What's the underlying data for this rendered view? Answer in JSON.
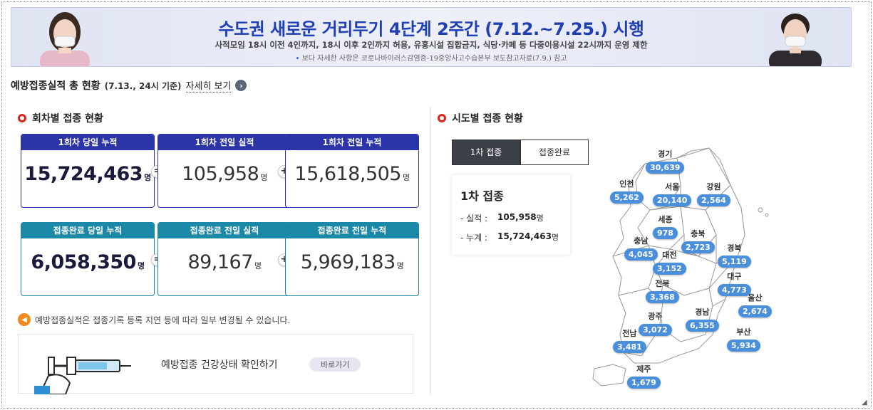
{
  "banner": {
    "title": "수도권 새로운 거리두기 4단계 2주간 (7.12.~7.25.) 시행",
    "subtitle": "사적모임 18시 이전 4인까지, 18시 이후 2인까지 허용, 유흥시설 집합금지, 식당·카페 등 다중이용시설 22시까지 운영 제한",
    "note": "보다 자세한 사항은 코로나바이러스감염증-19중앙사고수습본부 보도참고자료(7.9.) 참고"
  },
  "summary": {
    "title": "예방접종실적 총 현황",
    "date": "(7.13., 24시 기준)",
    "more_label": "자세히 보기"
  },
  "by_dose": {
    "title": "회차별 접종 현황",
    "row1": [
      {
        "label": "1회차 당일 누적",
        "value": "15,724,463",
        "unit": "명"
      },
      {
        "label": "1회차 전일 실적",
        "value": "105,958",
        "unit": "명"
      },
      {
        "label": "1회차 전일 누적",
        "value": "15,618,505",
        "unit": "명"
      }
    ],
    "row2": [
      {
        "label": "접종완료 당일 누적",
        "value": "6,058,350",
        "unit": "명"
      },
      {
        "label": "접종완료 전일 실적",
        "value": "89,167",
        "unit": "명"
      },
      {
        "label": "접종완료 전일 누적",
        "value": "5,969,183",
        "unit": "명"
      }
    ],
    "op_equals": "=",
    "op_plus": "+"
  },
  "notice": "예방접종실적은 접종기록 등록 지연 등에 따라 일부 변경될 수 있습니다.",
  "health": {
    "label": "예방접종 건강상태 확인하기",
    "go": "바로가기"
  },
  "by_region": {
    "title": "시도별 접종 현황",
    "tabs": [
      "1차 접종",
      "접종완료"
    ],
    "box_title": "1차 접종",
    "actual_label": "실적 :",
    "actual_value": "105,958",
    "total_label": "누계 :",
    "total_value": "15,724,463",
    "unit": "명",
    "regions": [
      {
        "name": "경기",
        "value": "30,639"
      },
      {
        "name": "인천",
        "value": "5,262"
      },
      {
        "name": "서울",
        "value": "20,140"
      },
      {
        "name": "강원",
        "value": "2,564"
      },
      {
        "name": "세종",
        "value": "978"
      },
      {
        "name": "충남",
        "value": "4,045"
      },
      {
        "name": "충북",
        "value": "2,723"
      },
      {
        "name": "대전",
        "value": "3,152"
      },
      {
        "name": "경북",
        "value": "5,119"
      },
      {
        "name": "대구",
        "value": "4,773"
      },
      {
        "name": "전북",
        "value": "3,368"
      },
      {
        "name": "울산",
        "value": "2,674"
      },
      {
        "name": "광주",
        "value": "3,072"
      },
      {
        "name": "경남",
        "value": "6,355"
      },
      {
        "name": "전남",
        "value": "3,481"
      },
      {
        "name": "부산",
        "value": "5,934"
      },
      {
        "name": "제주",
        "value": "1,679"
      }
    ]
  },
  "colors": {
    "dose1": "#2b34a8",
    "complete": "#1b88a8",
    "pill": "#4a8fdc",
    "banner_title": "#1e3fb5"
  }
}
